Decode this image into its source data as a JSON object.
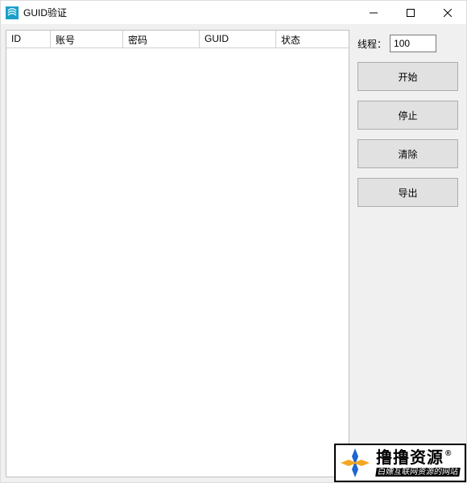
{
  "window": {
    "title": "GUID验证"
  },
  "table": {
    "headers": {
      "id": "ID",
      "account": "账号",
      "password": "密码",
      "guid": "GUID",
      "status": "状态"
    },
    "rows": []
  },
  "side": {
    "thread_label": "线程：",
    "thread_value": "100",
    "buttons": {
      "start": "开始",
      "stop": "停止",
      "clear": "清除",
      "export": "导出"
    }
  },
  "watermark": {
    "main": "撸撸资源",
    "r": "®",
    "sub": "白嫖互联网资源的网站"
  }
}
